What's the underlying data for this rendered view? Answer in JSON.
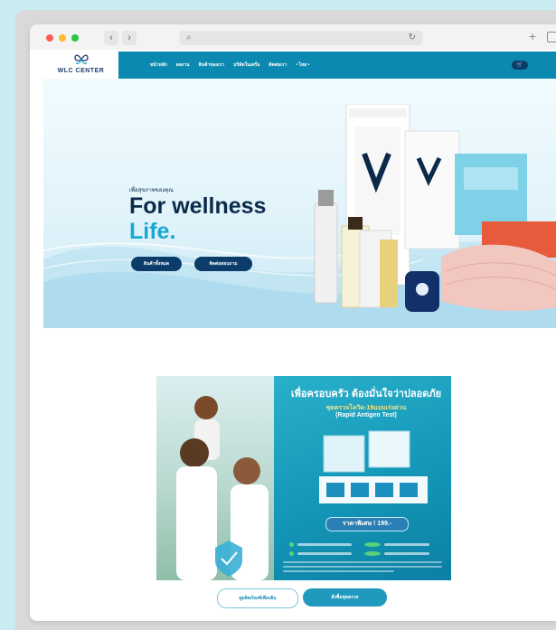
{
  "browser": {
    "back_glyph": "‹",
    "forward_glyph": "›",
    "search_glyph": "⌕",
    "reload_glyph": "↻",
    "new_tab_glyph": "+"
  },
  "site": {
    "logo_text": "WLC CENTER",
    "menu": [
      "หน้าหลัก",
      "ผลงาน",
      "สินค้าของเรา",
      "บริษัทในเครือ",
      "ติดต่อเรา",
      "• ไทย •"
    ],
    "cart_glyph": "🛒"
  },
  "hero": {
    "kicker": "เพื่อสุขภาพของคุณ",
    "title_line1": "For wellness",
    "title_line2": "Life.",
    "button1": "สินค้าทั้งหมด",
    "button2": "ติดต่อสอบถาม"
  },
  "promo": {
    "headline": "เพื่อครอบครัว ต้องมั่นใจว่าปลอดภัย",
    "subline1": "ชุดตรวจโควิด-19แบบเร่งด่วน",
    "subline2": "(Rapid Antigen Test)",
    "price": "ราคาพิเศษ ! 199.-"
  },
  "cta": {
    "secondary": "ดูผลิตภัณฑ์เพิ่มเติม",
    "primary": "สั่งซื้อชุดตรวจ"
  },
  "colors": {
    "brand_primary": "#0c89b0",
    "brand_dark": "#0b3c6a",
    "accent": "#1aa7d1",
    "page_bg": "#c9ecf3"
  }
}
